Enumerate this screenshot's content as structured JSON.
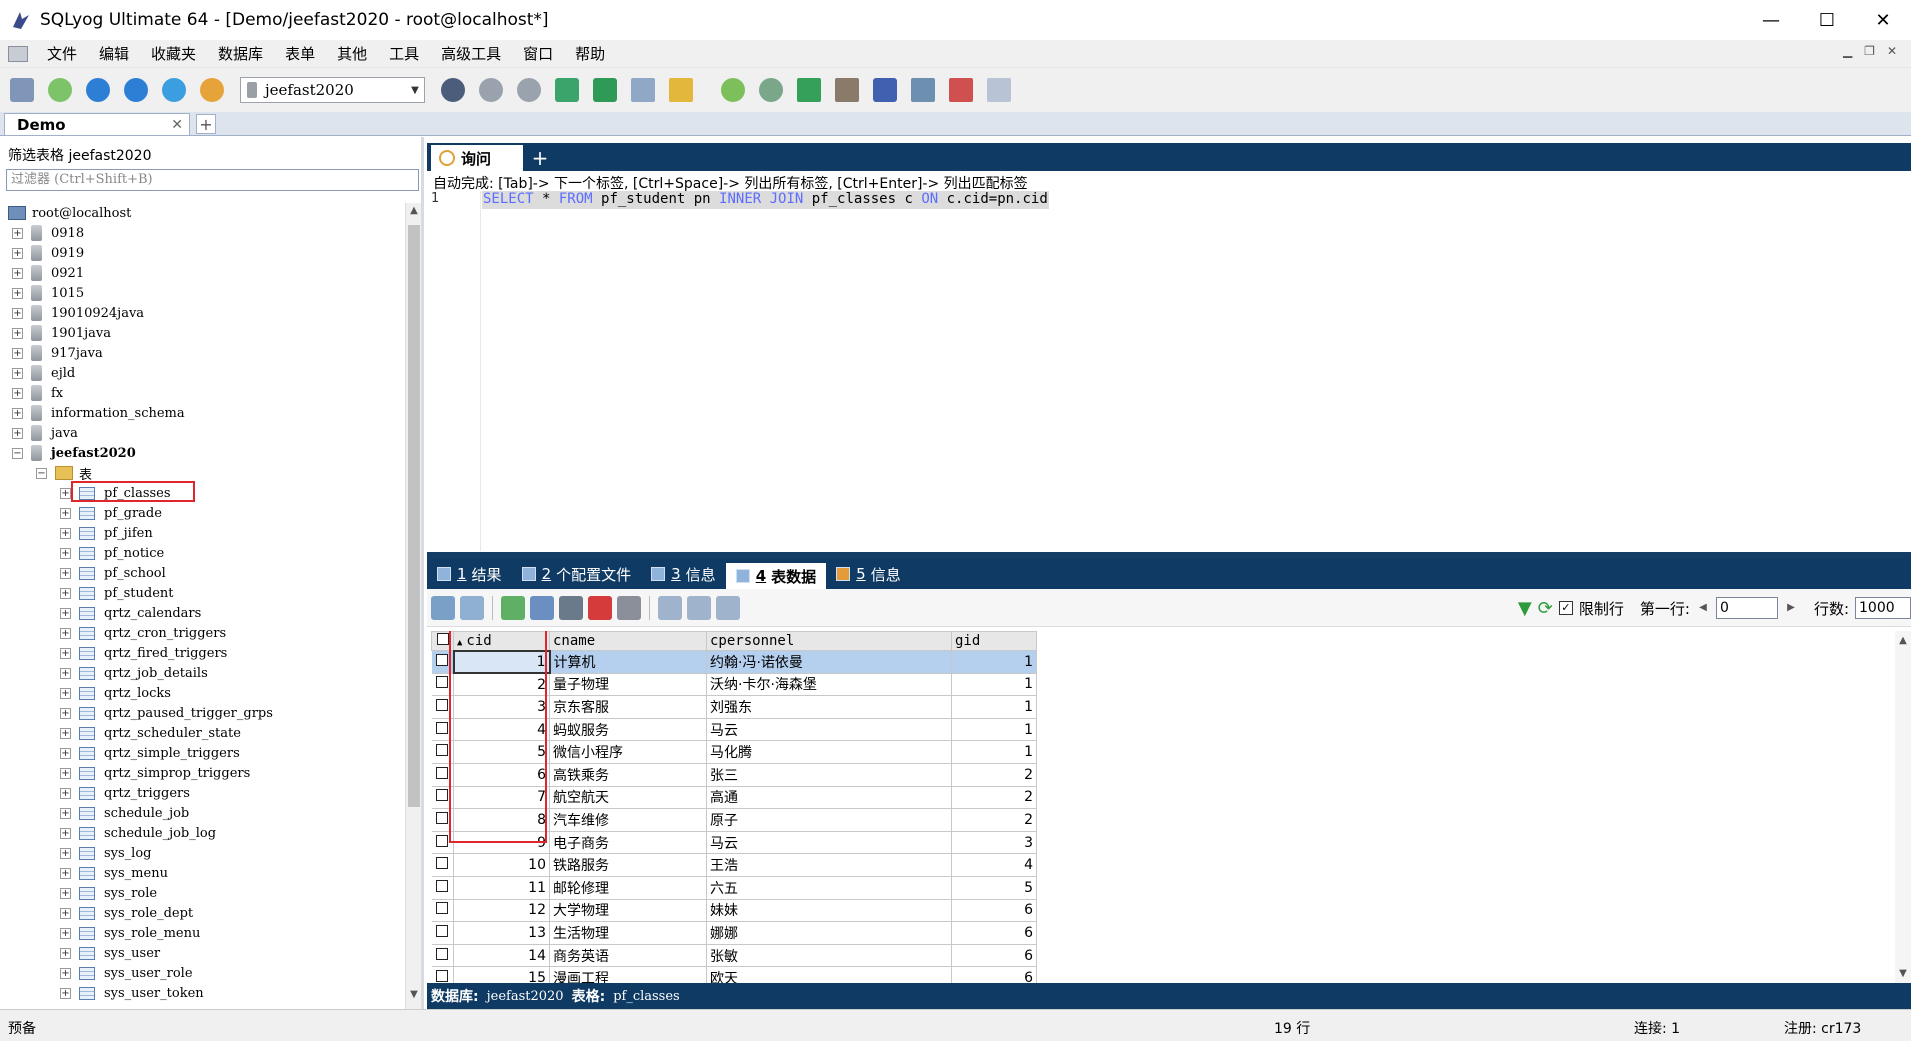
{
  "window": {
    "title": "SQLyog Ultimate 64 - [Demo/jeefast2020 - root@localhost*]",
    "controls": [
      "—",
      "☐",
      "✕"
    ]
  },
  "menu": [
    "文件",
    "编辑",
    "收藏夹",
    "数据库",
    "表单",
    "其他",
    "工具",
    "高级工具",
    "窗口",
    "帮助"
  ],
  "toolbar": {
    "database_selector": "jeefast2020"
  },
  "connection_tab": {
    "label": "Demo",
    "close": "✕",
    "add": "+"
  },
  "left": {
    "filter_label": "筛选表格 jeefast2020",
    "filter_placeholder": "过滤器 (Ctrl+Shift+B)",
    "root": "root@localhost",
    "databases": [
      "0918",
      "0919",
      "0921",
      "1015",
      "19010924java",
      "1901java",
      "917java",
      "ejld",
      "fx",
      "information_schema",
      "java"
    ],
    "open_db": "jeefast2020",
    "tables_folder": "表",
    "tables": [
      "pf_classes",
      "pf_grade",
      "pf_jifen",
      "pf_notice",
      "pf_school",
      "pf_student",
      "qrtz_calendars",
      "qrtz_cron_triggers",
      "qrtz_fired_triggers",
      "qrtz_job_details",
      "qrtz_locks",
      "qrtz_paused_trigger_grps",
      "qrtz_scheduler_state",
      "qrtz_simple_triggers",
      "qrtz_simprop_triggers",
      "qrtz_triggers",
      "schedule_job",
      "schedule_job_log",
      "sys_log",
      "sys_menu",
      "sys_role",
      "sys_role_dept",
      "sys_role_menu",
      "sys_user",
      "sys_user_role",
      "sys_user_token"
    ]
  },
  "query": {
    "tab_label": "询问",
    "add_tab": "+",
    "autocomplete_hint": "自动完成: [Tab]-> 下一个标签, [Ctrl+Space]-> 列出所有标签, [Ctrl+Enter]-> 列出匹配标签",
    "line_number": "1",
    "sql": {
      "k1": "SELECT",
      "t1": " * ",
      "k2": "FROM",
      "t2": " pf_student pn ",
      "k3": "INNER JOIN",
      "t3": " pf_classes c ",
      "k4": "ON",
      "t4": " c.cid=pn.cid"
    }
  },
  "result_tabs": [
    {
      "num": "1",
      "label": "结果"
    },
    {
      "num": "2",
      "label": "个配置文件"
    },
    {
      "num": "3",
      "label": "信息"
    },
    {
      "num": "4",
      "label": "表数据"
    },
    {
      "num": "5",
      "label": "信息"
    }
  ],
  "result_toolbar": {
    "limit_label": "限制行",
    "first_row_label": "第一行:",
    "first_row_value": "0",
    "rows_label": "行数:",
    "rows_value": "1000"
  },
  "grid": {
    "columns": [
      "cid",
      "cname",
      "cpersonnel",
      "gid"
    ],
    "sort_indicator": "▲",
    "rows": [
      [
        "1",
        "计算机",
        "约翰·冯·诺依曼",
        "1"
      ],
      [
        "2",
        "量子物理",
        "沃纳·卡尔·海森堡",
        "1"
      ],
      [
        "3",
        "京东客服",
        "刘强东",
        "1"
      ],
      [
        "4",
        "蚂蚁服务",
        "马云",
        "1"
      ],
      [
        "5",
        "微信小程序",
        "马化腾",
        "1"
      ],
      [
        "6",
        "高铁乘务",
        "张三",
        "2"
      ],
      [
        "7",
        "航空航天",
        "高通",
        "2"
      ],
      [
        "8",
        "汽车维修",
        "原子",
        "2"
      ],
      [
        "9",
        "电子商务",
        "马云",
        "3"
      ],
      [
        "10",
        "铁路服务",
        "王浩",
        "4"
      ],
      [
        "11",
        "邮轮修理",
        "六五",
        "5"
      ],
      [
        "12",
        "大学物理",
        "妹妹",
        "6"
      ],
      [
        "13",
        "生活物理",
        "娜娜",
        "6"
      ],
      [
        "14",
        "商务英语",
        "张敏",
        "6"
      ],
      [
        "15",
        "漫画工程",
        "欧天",
        "6"
      ]
    ]
  },
  "infobar": {
    "db_label": "数据库:",
    "db_value": "jeefast2020",
    "table_label": "表格:",
    "table_value": "pf_classes"
  },
  "status": {
    "left": "预备",
    "rows": "19 行",
    "conn": "连接: 1",
    "reg": "注册: cr173"
  }
}
